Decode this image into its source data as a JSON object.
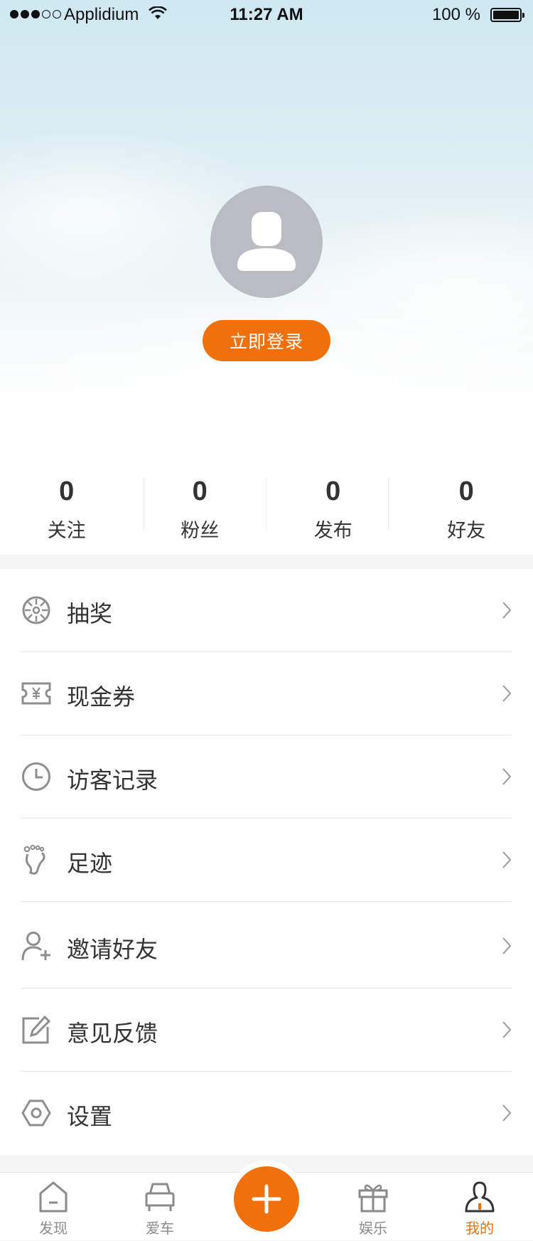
{
  "status_bar": {
    "carrier": "Applidium",
    "time": "11:27 AM",
    "battery": "100 %"
  },
  "profile": {
    "avatar_icon": "user-placeholder-icon",
    "login_label": "立即登录"
  },
  "stats": [
    {
      "value": "0",
      "label": "关注"
    },
    {
      "value": "0",
      "label": "粉丝"
    },
    {
      "value": "0",
      "label": "发布"
    },
    {
      "value": "0",
      "label": "好友"
    }
  ],
  "menu": [
    {
      "icon": "lottery-wheel-icon",
      "label": "抽奖"
    },
    {
      "icon": "cash-coupon-icon",
      "label": "现金券"
    },
    {
      "icon": "clock-icon",
      "label": "访客记录"
    },
    {
      "icon": "footprint-icon",
      "label": "足迹"
    },
    {
      "icon": "add-friend-icon",
      "label": "邀请好友"
    },
    {
      "icon": "feedback-edit-icon",
      "label": "意见反馈"
    },
    {
      "icon": "settings-hex-icon",
      "label": "设置"
    }
  ],
  "tabbar": {
    "items": [
      {
        "icon": "home-icon",
        "label": "发现"
      },
      {
        "icon": "car-icon",
        "label": "爱车"
      },
      {
        "icon": "gift-icon",
        "label": "娱乐"
      },
      {
        "icon": "person-icon",
        "label": "我的"
      }
    ],
    "active_index": 3,
    "plus_icon": "plus-icon"
  },
  "colors": {
    "accent": "#f0700c",
    "avatar_bg": "#b9bcc3",
    "icon_gray": "#8e8e8e"
  }
}
